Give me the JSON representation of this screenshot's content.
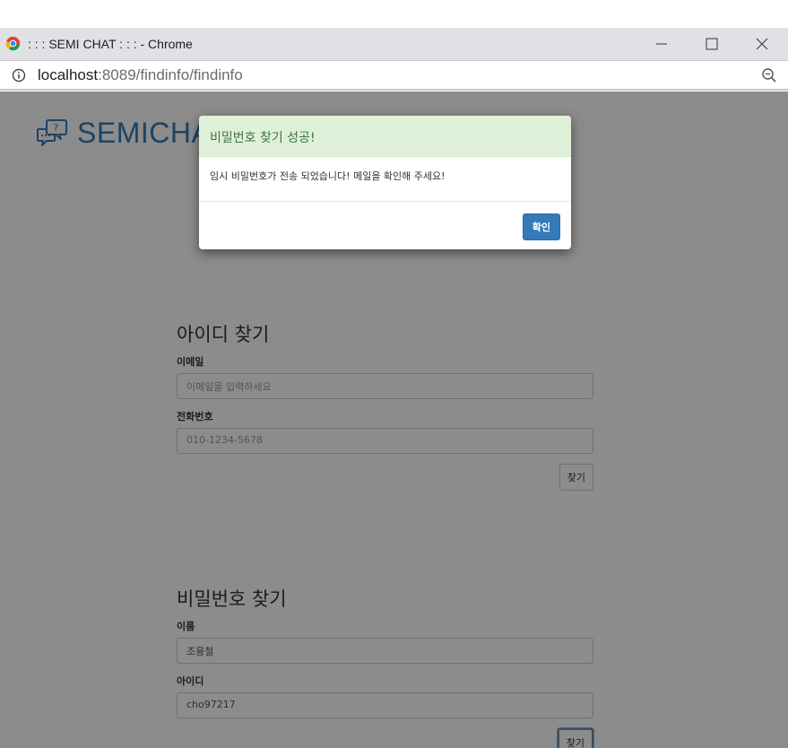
{
  "window": {
    "title": ": : : SEMI CHAT : : : - Chrome",
    "minimize_icon": "minimize-icon",
    "maximize_icon": "maximize-icon",
    "close_icon": "close-icon"
  },
  "address_bar": {
    "host": "localhost",
    "path": ":8089/findinfo/findinfo",
    "info_icon": "info-icon",
    "zoom_icon": "zoom-out-icon"
  },
  "logo": {
    "text": "SEMICHAT",
    "icon": "chat-question-icon",
    "color": "#337ab7"
  },
  "find_id": {
    "heading": "아이디 찾기",
    "email_label": "이메일",
    "email_placeholder": "이메일을 입력하세요",
    "phone_label": "전화번호",
    "phone_placeholder": "010-1234-5678",
    "submit_label": "찾기"
  },
  "find_password": {
    "heading": "비밀번호 찾기",
    "name_label": "이름",
    "name_value": "조용철",
    "id_label": "아이디",
    "id_value": "cho97217",
    "submit_label": "찾기"
  },
  "modal": {
    "title": "비밀번호 찾기 성공!",
    "message": "임시 비밀번호가 전송 되었습니다! 메일을 확인해 주세요!",
    "confirm_label": "확인",
    "header_color": "#dff0d8",
    "title_color": "#3c763d"
  }
}
